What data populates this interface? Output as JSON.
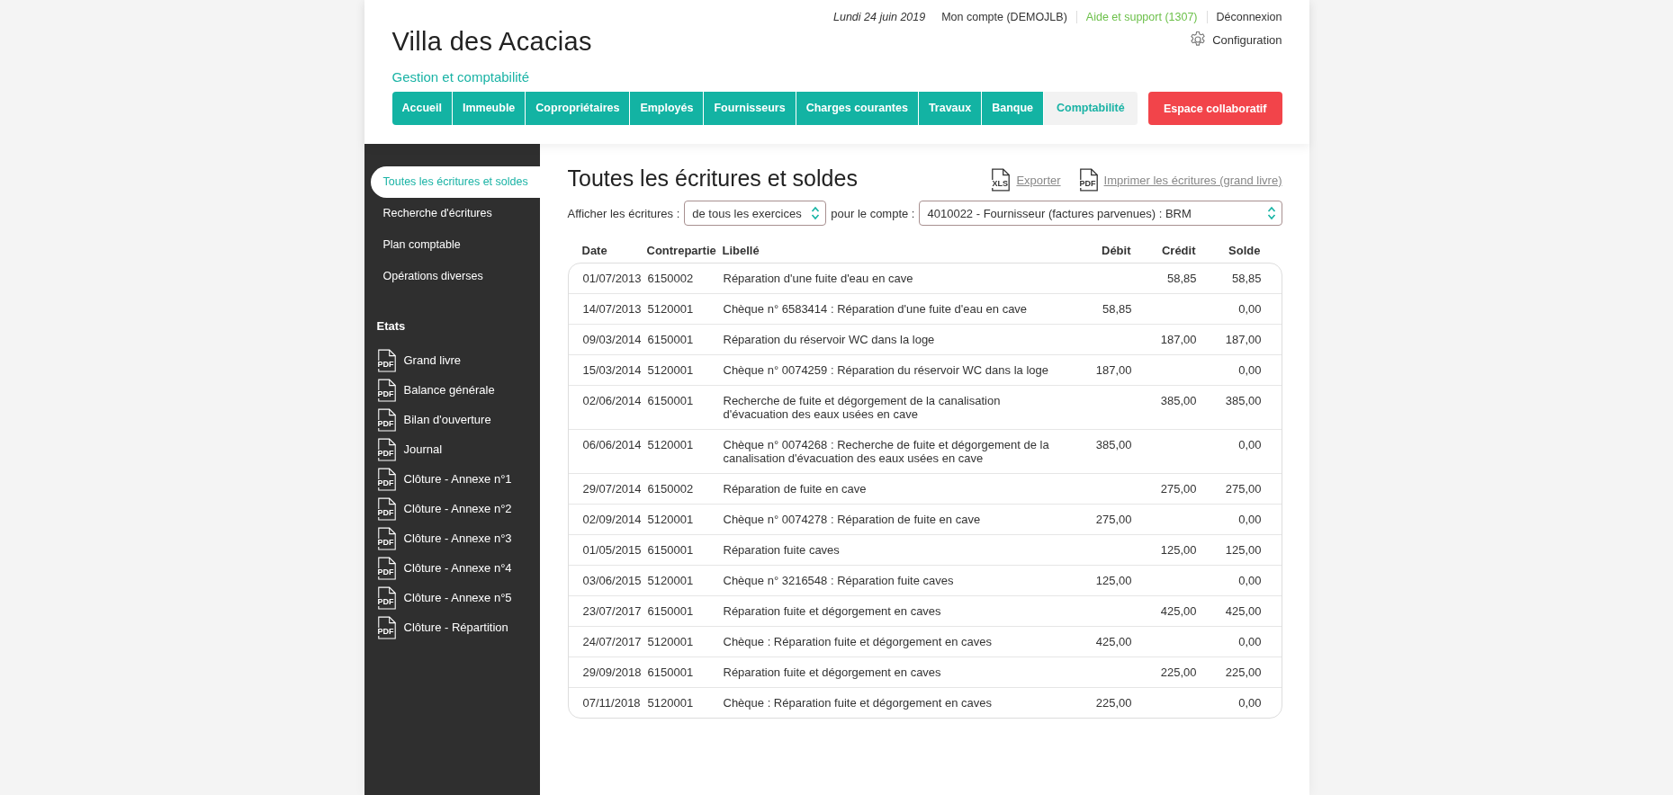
{
  "header": {
    "date": "Lundi 24 juin 2019",
    "account": "Mon compte (DEMOJLB)",
    "support": "Aide et support (1307)",
    "logout": "Déconnexion",
    "settings": "Configuration",
    "title": "Villa des Acacias",
    "subtitle": "Gestion et comptabilité"
  },
  "nav": [
    {
      "label": "Accueil",
      "selected": false
    },
    {
      "label": "Immeuble",
      "selected": false
    },
    {
      "label": "Copropriétaires",
      "selected": false
    },
    {
      "label": "Employés",
      "selected": false
    },
    {
      "label": "Fournisseurs",
      "selected": false
    },
    {
      "label": "Charges courantes",
      "selected": false
    },
    {
      "label": "Travaux",
      "selected": false
    },
    {
      "label": "Banque",
      "selected": false
    },
    {
      "label": "Comptabilité",
      "selected": true
    }
  ],
  "collab_button": "Espace collaboratif",
  "sidebar": {
    "items": [
      {
        "label": "Toutes les écritures et soldes",
        "selected": true
      },
      {
        "label": "Recherche d'écritures",
        "selected": false
      },
      {
        "label": "Plan comptable",
        "selected": false
      },
      {
        "label": "Opérations diverses",
        "selected": false
      }
    ],
    "reports_heading": "Etats",
    "reports": [
      {
        "icon_label": "PDF",
        "label": "Grand livre"
      },
      {
        "icon_label": "PDF",
        "label": "Balance générale"
      },
      {
        "icon_label": "PDF",
        "label": "Bilan d'ouverture"
      },
      {
        "icon_label": "PDF",
        "label": "Journal"
      },
      {
        "icon_label": "PDF",
        "label": "Clôture - Annexe n°1"
      },
      {
        "icon_label": "PDF",
        "label": "Clôture - Annexe n°2"
      },
      {
        "icon_label": "PDF",
        "label": "Clôture - Annexe n°3"
      },
      {
        "icon_label": "PDF",
        "label": "Clôture - Annexe n°4"
      },
      {
        "icon_label": "PDF",
        "label": "Clôture - Annexe n°5"
      },
      {
        "icon_label": "PDF",
        "label": "Clôture - Répartition"
      }
    ]
  },
  "page_title": "Toutes les écritures et soldes",
  "actions": [
    {
      "icon_label": "XLS",
      "label": "Exporter"
    },
    {
      "icon_label": "PDF",
      "label": "Imprimer les écritures (grand livre)"
    }
  ],
  "filters": {
    "label_1": "Afficher les écritures :",
    "select_1": "de tous les exercices",
    "label_2": "pour le compte :",
    "select_2": "4010022 - Fournisseur (factures parvenues) : BRM"
  },
  "table": {
    "columns": [
      "Date",
      "Contrepartie",
      "Libellé",
      "Débit",
      "Crédit",
      "Solde"
    ],
    "rows": [
      {
        "date": "01/07/2013",
        "contre": "6150002",
        "libelle": "Réparation d'une fuite d'eau en cave",
        "credit": "58,85",
        "solde": "58,85"
      },
      {
        "date": "14/07/2013",
        "contre": "5120001",
        "libelle": "Chèque n° 6583414 : Réparation d'une fuite d'eau en cave",
        "debit": "58,85",
        "solde": "0,00"
      },
      {
        "date": "09/03/2014",
        "contre": "6150001",
        "libelle": "Réparation du réservoir WC dans la loge",
        "credit": "187,00",
        "solde": "187,00"
      },
      {
        "date": "15/03/2014",
        "contre": "5120001",
        "libelle": "Chèque n° 0074259 : Réparation du réservoir WC dans la loge",
        "debit": "187,00",
        "solde": "0,00"
      },
      {
        "date": "02/06/2014",
        "contre": "6150001",
        "libelle": "Recherche de fuite et dégorgement de la canalisation d'évacuation des eaux usées en cave",
        "credit": "385,00",
        "solde": "385,00"
      },
      {
        "date": "06/06/2014",
        "contre": "5120001",
        "libelle": "Chèque n° 0074268 : Recherche de fuite et dégorgement de la canalisation d'évacuation des eaux usées en cave",
        "debit": "385,00",
        "solde": "0,00"
      },
      {
        "date": "29/07/2014",
        "contre": "6150002",
        "libelle": "Réparation de fuite en cave",
        "credit": "275,00",
        "solde": "275,00"
      },
      {
        "date": "02/09/2014",
        "contre": "5120001",
        "libelle": "Chèque n° 0074278 : Réparation de fuite en cave",
        "debit": "275,00",
        "solde": "0,00"
      },
      {
        "date": "01/05/2015",
        "contre": "6150001",
        "libelle": "Réparation fuite caves",
        "credit": "125,00",
        "solde": "125,00"
      },
      {
        "date": "03/06/2015",
        "contre": "5120001",
        "libelle": "Chèque n° 3216548 : Réparation fuite caves",
        "debit": "125,00",
        "solde": "0,00"
      },
      {
        "date": "23/07/2017",
        "contre": "6150001",
        "libelle": "Réparation fuite et dégorgement en caves",
        "credit": "425,00",
        "solde": "425,00"
      },
      {
        "date": "24/07/2017",
        "contre": "5120001",
        "libelle": "Chèque : Réparation fuite et dégorgement en caves",
        "debit": "425,00",
        "solde": "0,00"
      },
      {
        "date": "29/09/2018",
        "contre": "6150001",
        "libelle": "Réparation fuite et dégorgement en caves",
        "credit": "225,00",
        "solde": "225,00"
      },
      {
        "date": "07/11/2018",
        "contre": "5120001",
        "libelle": "Chèque : Réparation fuite et dégorgement en caves",
        "debit": "225,00",
        "solde": "0,00"
      }
    ]
  }
}
